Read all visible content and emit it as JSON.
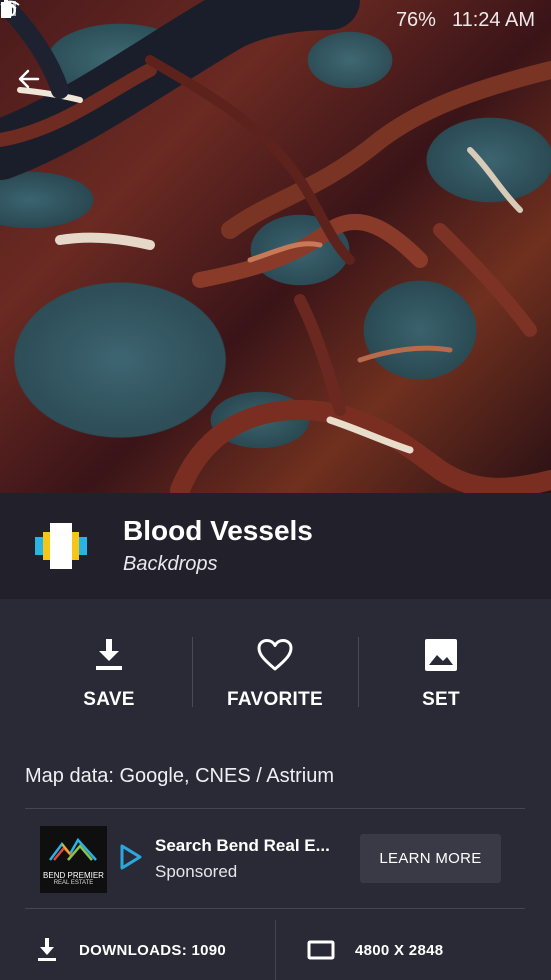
{
  "status_bar": {
    "battery": "76%",
    "time": "11:24 AM"
  },
  "wallpaper": {
    "title": "Blood Vessels",
    "collection": "Backdrops",
    "attribution": "Map data: Google, CNES / Astrium"
  },
  "actions": [
    {
      "label": "SAVE",
      "icon": "download-icon"
    },
    {
      "label": "FAVORITE",
      "icon": "heart-outline-icon"
    },
    {
      "label": "SET",
      "icon": "image-icon"
    }
  ],
  "ad": {
    "logo_text_line1": "BEND PREMIER",
    "logo_text_line2": "REAL ESTATE",
    "headline": "Search Bend Real E...",
    "sponsored": "Sponsored",
    "cta": "LEARN MORE"
  },
  "stats": {
    "downloads": "DOWNLOADS: 1090",
    "resolution": "4800 X 2848"
  },
  "colors": {
    "background": "#2a2a36",
    "title_bar": "#22212b",
    "cta_button": "#3a3a46",
    "accent_blue": "#29a8e0"
  }
}
